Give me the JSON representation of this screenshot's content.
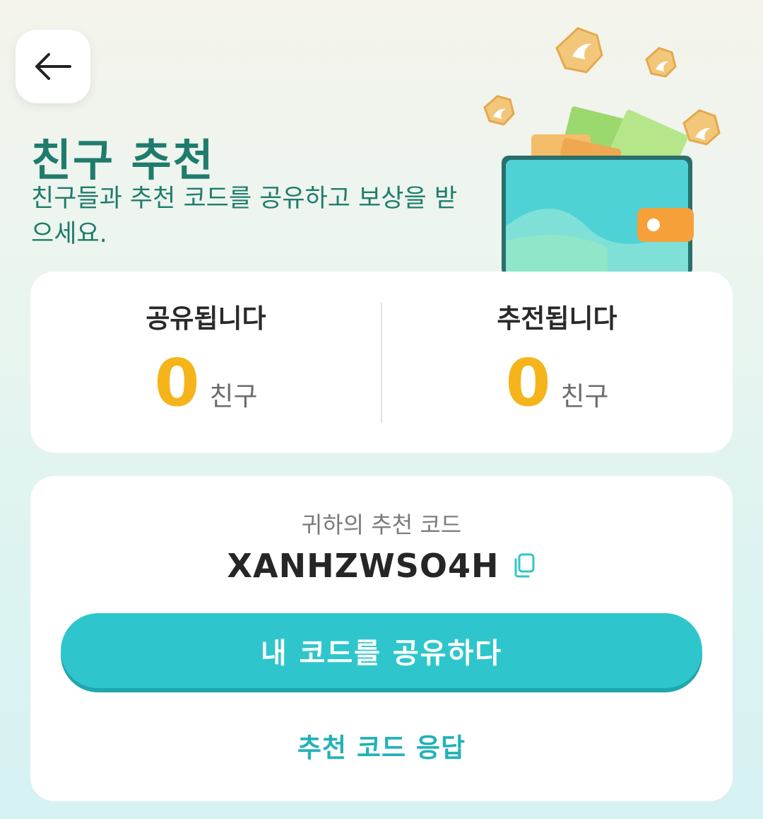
{
  "header": {
    "back_icon": "arrow-left-icon",
    "title": "친구 추천",
    "subtitle": "친구들과 추천 코드를 공유하고 보상을 받으세요."
  },
  "stats": {
    "shared_label": "공유됩니다",
    "shared_value": "0",
    "shared_unit": "친구",
    "referred_label": "추전됩니다",
    "referred_value": "0",
    "referred_unit": "친구"
  },
  "code": {
    "label": "귀하의 추천 코드",
    "value": "XANHZWSO4H",
    "copy_icon": "copy-icon"
  },
  "actions": {
    "share_label": "내 코드를 공유하다",
    "reply_label": "추천 코드 응답"
  },
  "colors": {
    "title": "#1f7c6c",
    "accent": "#2ec6cc",
    "value": "#f5b41a",
    "link": "#22b2b8"
  }
}
